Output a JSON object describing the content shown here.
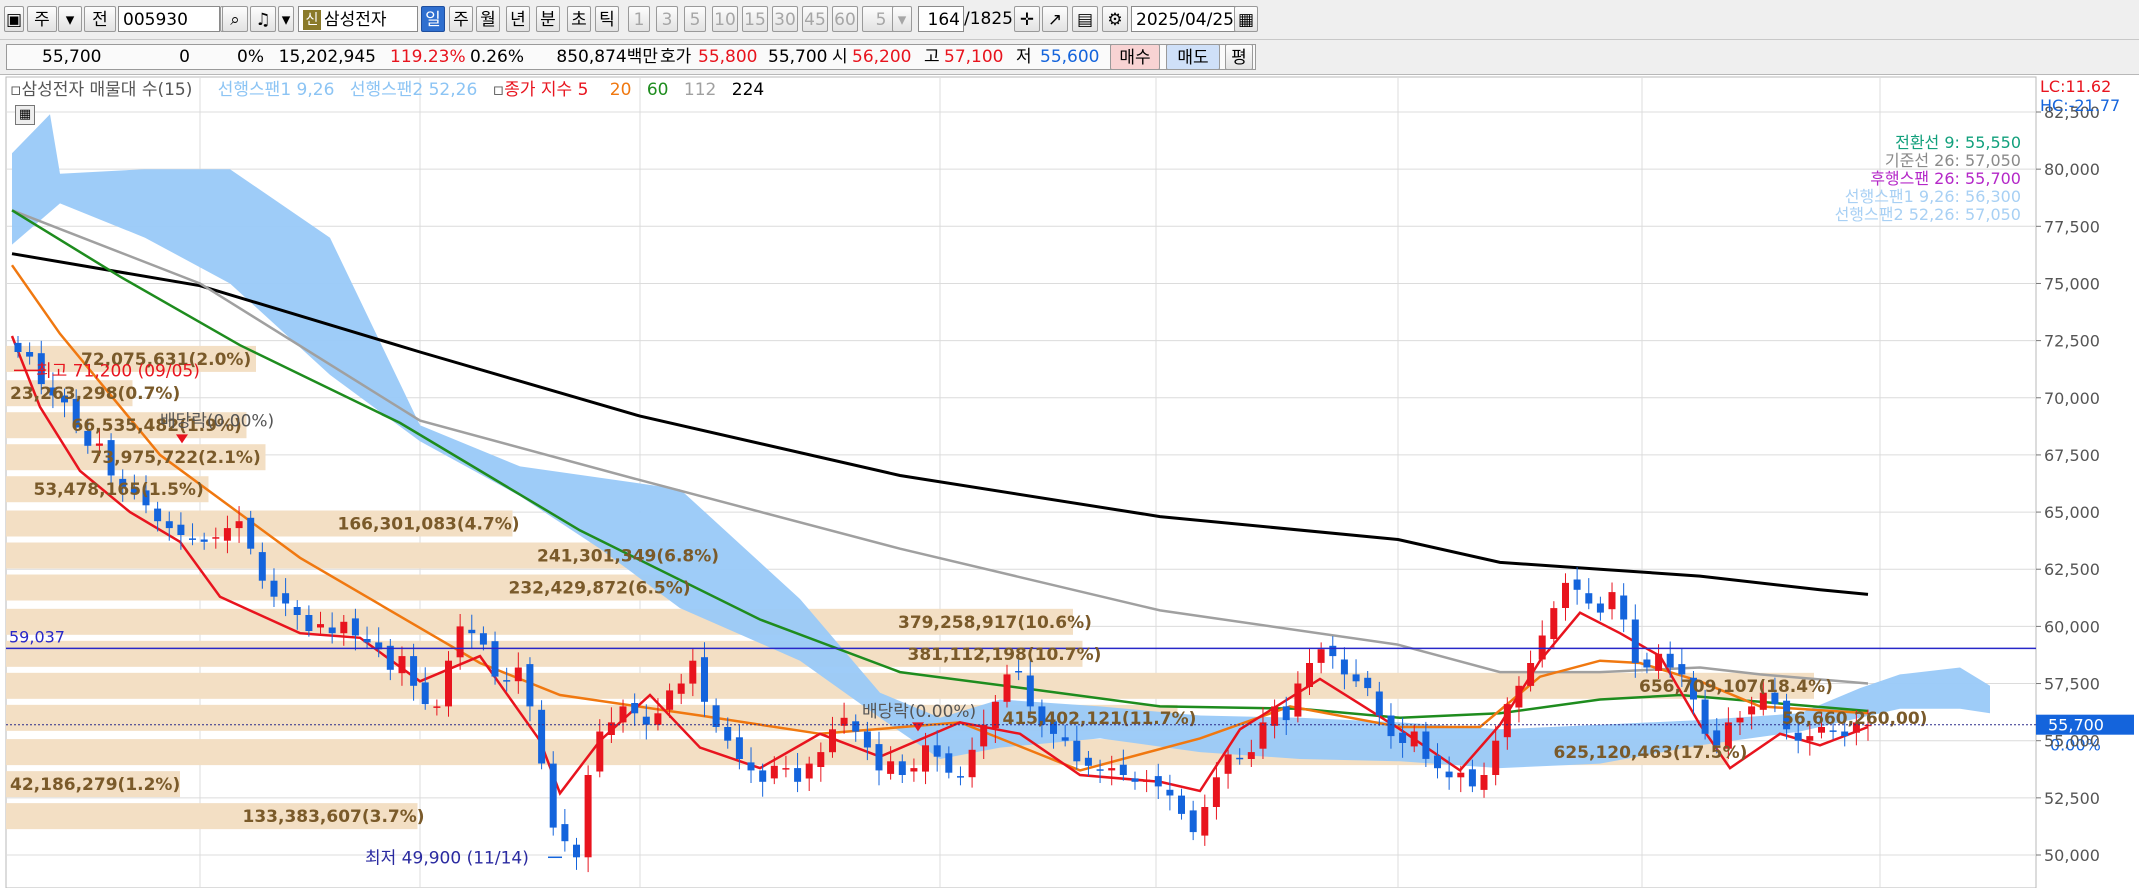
{
  "toolbar": {
    "period_labels": [
      "주",
      "전"
    ],
    "code": "005930",
    "shin_badge": "신",
    "stock_name": "삼성전자",
    "periods": [
      {
        "label": "일",
        "active": true
      },
      {
        "label": "주",
        "active": false
      },
      {
        "label": "월",
        "active": false
      },
      {
        "label": "년",
        "active": false
      },
      {
        "label": "분",
        "active": false
      },
      {
        "label": "초",
        "active": false
      },
      {
        "label": "틱",
        "active": false
      }
    ],
    "intervals": [
      "1",
      "3",
      "5",
      "10",
      "15",
      "30",
      "45",
      "60"
    ],
    "interval_select": "5",
    "count_value": "164",
    "count_total": "/1825",
    "date": "2025/04/25"
  },
  "quote": {
    "price": "55,700",
    "change": "0",
    "change_pct": "0%",
    "volume": "15,202,945",
    "volume_ratio": "119.23%",
    "turnover": "0.26%",
    "amount": "850,874백만",
    "ask_label": "호가",
    "ask": "55,800",
    "bid": "55,700",
    "open_label": "시",
    "open": "56,200",
    "high_label": "고",
    "high": "57,100",
    "low_label": "저",
    "low": "55,600",
    "buy_label": "매수",
    "sell_label": "매도",
    "eval_label": "평"
  },
  "colors": {
    "up": "#e8141e",
    "down": "#1464dc",
    "cloud": "#99c9f8",
    "profile": "#f3dfc4",
    "ma5": "#e8141e",
    "ma20": "#f07810",
    "ma60": "#1e8c1e",
    "ma112": "#a0a0a0",
    "ma224": "#000000",
    "hline": "#2828c8"
  },
  "legend": {
    "profile": "삼성전자 매물대 수(15)",
    "span1": "선행스팬1 9,26",
    "span2": "선행스팬2 52,26",
    "ma_title": "종가 지수 5",
    "ma20": "20",
    "ma60": "60",
    "ma112": "112",
    "ma224": "224"
  },
  "ichimoku_info": {
    "conversion": "전환선 9: 55,550",
    "base": "기준선 26: 57,050",
    "lagging": "후행스팬 26: 55,700",
    "span1": "선행스팬1 9,26: 56,300",
    "span2": "선행스팬2 52,26: 57,050"
  },
  "corner": {
    "lc": "LC:11.62",
    "hc": "HC:-21.77"
  },
  "chart_data": {
    "type": "candlestick",
    "ylim": [
      49200,
      83800
    ],
    "y_ticks": [
      "82,500",
      "80,000",
      "77,500",
      "75,000",
      "72,500",
      "70,000",
      "67,500",
      "65,000",
      "62,500",
      "60,000",
      "57,500",
      "55,000",
      "52,500",
      "50,000"
    ],
    "current_price_label": "55,700",
    "current_pct_label": "0.00%",
    "hline_value": 59037,
    "hline_label": "59,037",
    "annotations": {
      "high": "최고 71,200 (09/05)",
      "low": "최저 49,900 (11/14)",
      "dividend1": "배당락(0.00%)",
      "dividend2": "배당락(0.00%)"
    },
    "high_value": 71200,
    "low_value": 49900,
    "volume_profile": [
      {
        "label": "72,075,631(2.0%)",
        "price": 71700
      },
      {
        "label": "23,263,298(0.7%)",
        "price": 70200
      },
      {
        "label": "66,535,482(1.9%)",
        "price": 68800
      },
      {
        "label": "73,975,722(2.1%)",
        "price": 67400
      },
      {
        "label": "53,478,165(1.5%)",
        "price": 66000
      },
      {
        "label": "166,301,083(4.7%)",
        "price": 64500
      },
      {
        "label": "241,301,349(6.8%)",
        "price": 63100
      },
      {
        "label": "232,429,872(6.5%)",
        "price": 61700
      },
      {
        "label": "379,258,917(10.6%)",
        "price": 60200
      },
      {
        "label": "381,112,198(10.7%)",
        "price": 58800
      },
      {
        "label": "656,709,107(18.4%)",
        "price": 57400
      },
      {
        "label": "415,402,121(11.7%)",
        "price": 56000
      },
      {
        "label": "625,120,463(17.5%)",
        "price": 54500
      },
      {
        "label": "42,186,279(1.2%)",
        "price": 53100
      },
      {
        "label": "133,383,607(3.7%)",
        "price": 51700
      }
    ],
    "profile_overlap_label": "56,660,260,00)"
  }
}
